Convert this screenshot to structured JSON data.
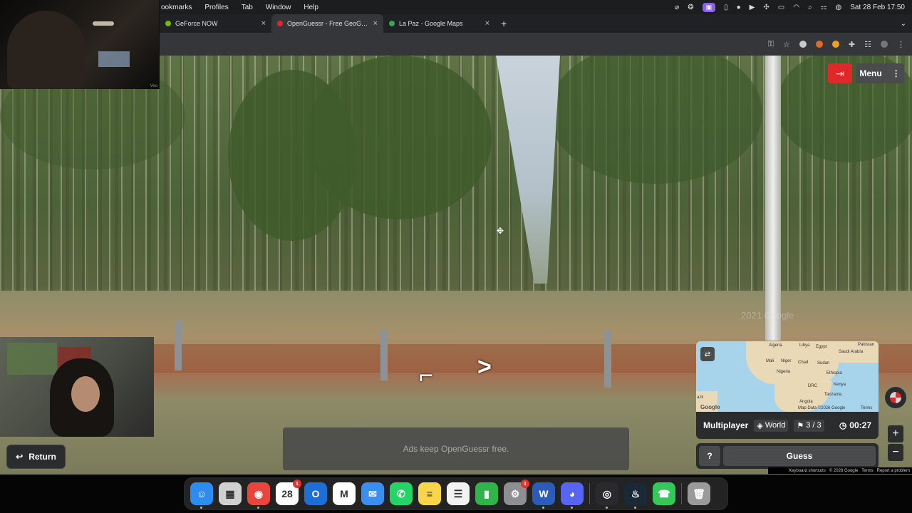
{
  "menubar": {
    "menus": [
      "ookmarks",
      "Profiles",
      "Tab",
      "Window",
      "Help"
    ],
    "datetime": "Sat 28 Feb  17:50",
    "status_icons": [
      "mic-off-icon",
      "chatgpt-icon",
      "screen-record-icon",
      "battery-icon",
      "spotify-icon",
      "play-icon",
      "fan-icon",
      "battery-charging-icon",
      "wifi-icon",
      "search-icon",
      "control-center-icon",
      "siri-icon"
    ]
  },
  "tabs": [
    {
      "title": "GeForce NOW",
      "favicon_color": "#76b900",
      "active": false
    },
    {
      "title": "OpenGuessr - Free GeoGuessr",
      "favicon_color": "#e0282b",
      "active": true
    },
    {
      "title": "La Paz - Google Maps",
      "favicon_color": "#34a853",
      "active": false
    }
  ],
  "toolbar": {
    "new_tab": "+",
    "tab_menu": "⌄"
  },
  "game": {
    "menu_label": "Menu",
    "mode": "Multiplayer",
    "map": "World",
    "round": "3 / 3",
    "timer": "00:27",
    "guess_label": "Guess",
    "help_label": "?",
    "return_label": "Return",
    "ad_text": "Ads keep OpenGuessr free.",
    "watermark": "2021 Google"
  },
  "minimap": {
    "labels": [
      "Algeria",
      "Libya",
      "Egypt",
      "Saudi Arabia",
      "Pakistan",
      "Mali",
      "Niger",
      "Chad",
      "Sudan",
      "Nigeria",
      "Ethiopia",
      "DRC",
      "Kenya",
      "Tanzania",
      "Angola",
      "azil"
    ],
    "logo": "Google",
    "map_data": "Map Data ©2026 Google",
    "terms": "Terms"
  },
  "footer": {
    "keyboard": "Keyboard shortcuts",
    "copyright": "© 2026 Google",
    "terms": "Terms",
    "report": "Report a problem"
  },
  "dock": [
    {
      "name": "finder",
      "glyph": "☺",
      "color": "#2d8cf0",
      "badge": "",
      "running": true
    },
    {
      "name": "launchpad",
      "glyph": "▦",
      "color": "#d0d0d0",
      "badge": "",
      "running": false
    },
    {
      "name": "chrome",
      "glyph": "◉",
      "color": "#e8453c",
      "badge": "",
      "running": true
    },
    {
      "name": "calendar",
      "glyph": "28",
      "color": "#ffffff",
      "badge": "1",
      "running": false
    },
    {
      "name": "outlook",
      "glyph": "O",
      "color": "#1d6fd6",
      "badge": "",
      "running": false
    },
    {
      "name": "gmail",
      "glyph": "M",
      "color": "#ffffff",
      "badge": "",
      "running": false
    },
    {
      "name": "mail",
      "glyph": "✉",
      "color": "#3a8ef0",
      "badge": "",
      "running": false
    },
    {
      "name": "whatsapp",
      "glyph": "✆",
      "color": "#25d366",
      "badge": "",
      "running": false
    },
    {
      "name": "notes",
      "glyph": "≡",
      "color": "#f7d64a",
      "badge": "",
      "running": false
    },
    {
      "name": "reminders",
      "glyph": "☰",
      "color": "#f2f2f2",
      "badge": "",
      "running": false
    },
    {
      "name": "numbers",
      "glyph": "▮",
      "color": "#2fb34a",
      "badge": "",
      "running": false
    },
    {
      "name": "system-settings",
      "glyph": "⚙",
      "color": "#8e8e93",
      "badge": "1",
      "running": false
    },
    {
      "name": "word",
      "glyph": "W",
      "color": "#2b5cb8",
      "badge": "",
      "running": true
    },
    {
      "name": "discord",
      "glyph": "◕",
      "color": "#5865f2",
      "badge": "",
      "running": true
    },
    {
      "name": "obs",
      "glyph": "◎",
      "color": "#2a2a2e",
      "badge": "",
      "running": true
    },
    {
      "name": "steam",
      "glyph": "♨",
      "color": "#1b2838",
      "badge": "",
      "running": true
    },
    {
      "name": "phone",
      "glyph": "☎",
      "color": "#34c759",
      "badge": "",
      "running": false
    },
    {
      "name": "trash",
      "glyph": "🗑",
      "color": "#9a9a9a",
      "badge": "",
      "running": false
    }
  ]
}
